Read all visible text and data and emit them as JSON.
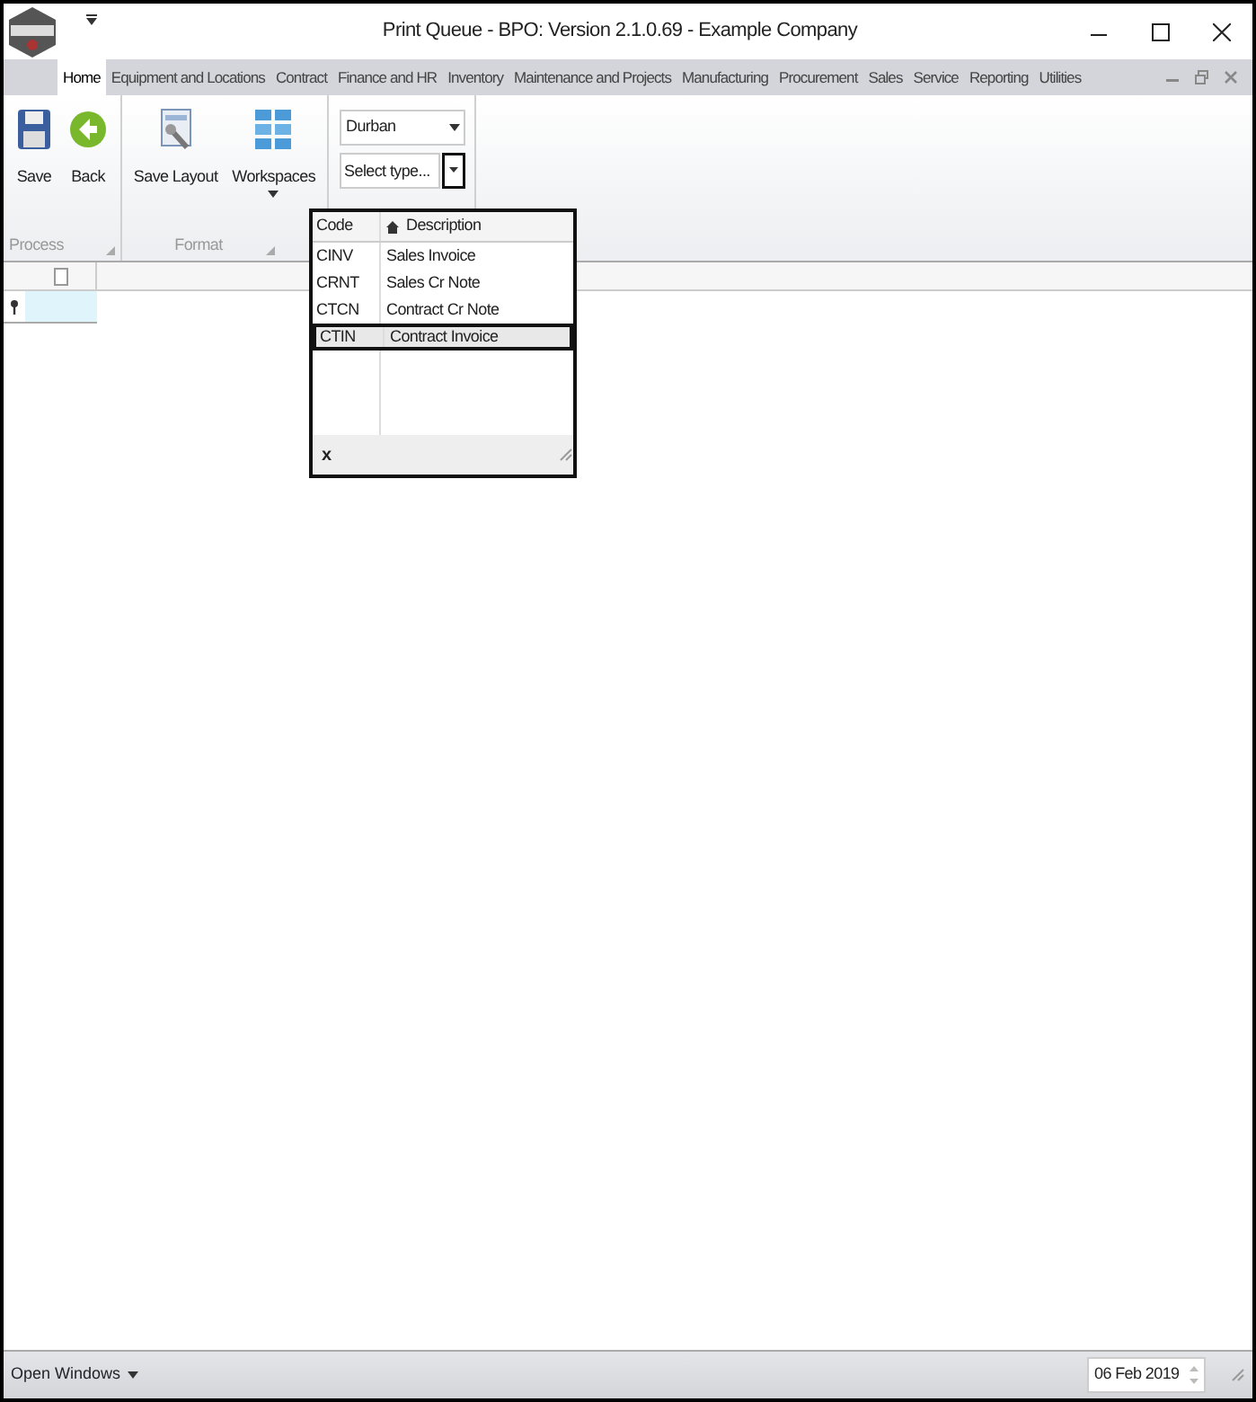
{
  "window": {
    "title": "Print Queue - BPO: Version 2.1.0.69 - Example Company"
  },
  "tabs": [
    {
      "label": "Home",
      "selected": true
    },
    {
      "label": "Equipment and Locations",
      "selected": false
    },
    {
      "label": "Contract",
      "selected": false
    },
    {
      "label": "Finance and HR",
      "selected": false
    },
    {
      "label": "Inventory",
      "selected": false
    },
    {
      "label": "Maintenance and Projects",
      "selected": false
    },
    {
      "label": "Manufacturing",
      "selected": false
    },
    {
      "label": "Procurement",
      "selected": false
    },
    {
      "label": "Sales",
      "selected": false
    },
    {
      "label": "Service",
      "selected": false
    },
    {
      "label": "Reporting",
      "selected": false
    },
    {
      "label": "Utilities",
      "selected": false
    }
  ],
  "ribbon_groups": [
    {
      "label": "Process",
      "buttons": [
        {
          "label": "Save",
          "kind": "save",
          "dropdown": false
        },
        {
          "label": "Back",
          "kind": "back",
          "dropdown": false
        }
      ]
    },
    {
      "label": "Format",
      "buttons": [
        {
          "label": "Save Layout",
          "kind": "layout",
          "dropdown": false
        },
        {
          "label": "Workspaces",
          "kind": "workspaces",
          "dropdown": true
        }
      ]
    }
  ],
  "filters": {
    "branch": "Durban",
    "type_placeholder": "Select type..."
  },
  "popup": {
    "columns": [
      "Code",
      "Description"
    ],
    "rows": [
      {
        "code": "CINV",
        "description": "Sales Invoice",
        "selected": false
      },
      {
        "code": "CRNT",
        "description": "Sales Cr Note",
        "selected": false
      },
      {
        "code": "CTCN",
        "description": "Contract Cr Note",
        "selected": false
      },
      {
        "code": "CTIN",
        "description": "Contract Invoice",
        "selected": true
      }
    ],
    "clear_label": "x"
  },
  "status_bar": {
    "open_windows": "Open Windows",
    "date": "06 Feb 2019"
  }
}
